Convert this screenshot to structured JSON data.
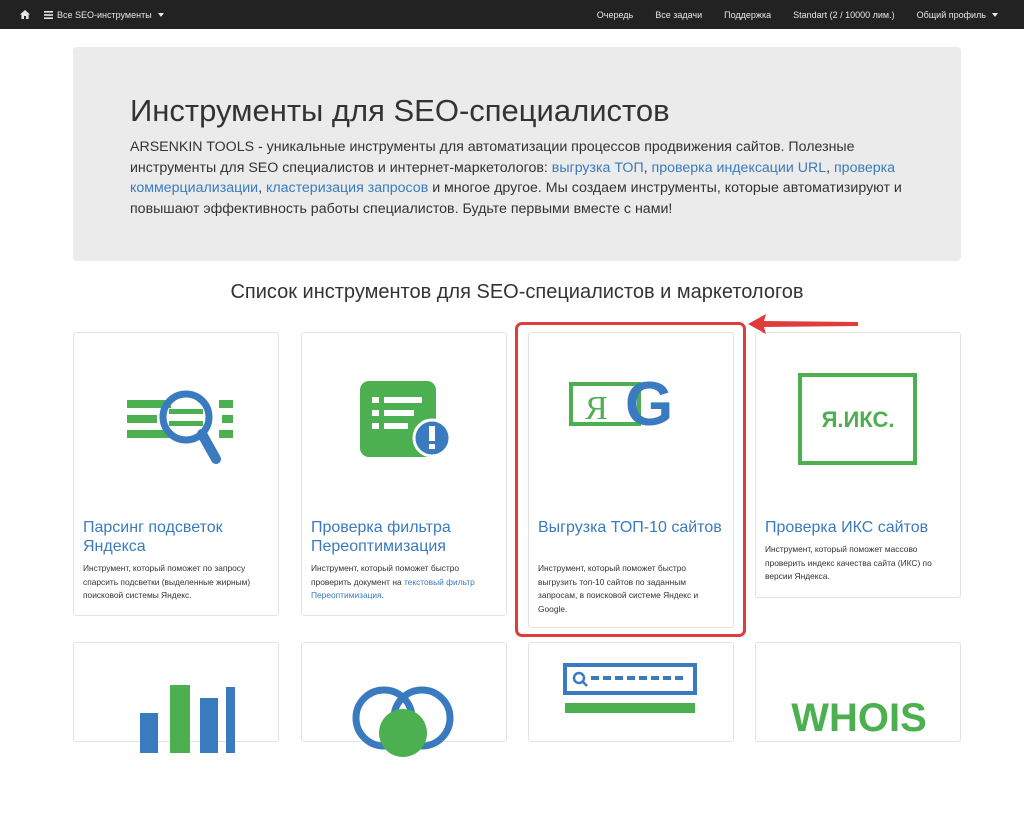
{
  "navbar": {
    "tools_menu": "Все SEO-инструменты",
    "queue": "Очередь",
    "all_tasks": "Все задачи",
    "support": "Поддержка",
    "plan": "Standart (2 / 10000 лим.)",
    "profile": "Общий профиль"
  },
  "jumbotron": {
    "title": "Инструменты для SEO-специалистов",
    "text_1": "ARSENKIN TOOLS - уникальные инструменты для автоматизации процессов продвижения сайтов. Полезные инструменты для SEO специалистов и интернет-маркетологов: ",
    "link_1": "выгрузка ТОП",
    "sep_1": ", ",
    "link_2": "проверка индексации URL",
    "sep_2": ", ",
    "link_3": "проверка коммерциализации",
    "sep_3": ", ",
    "link_4": "кластеризация запросов",
    "text_2": " и многое другое. Мы создаем инструменты, которые автоматизируют и повышают эффективность работы специалистов. Будьте первыми вместе с нами!"
  },
  "section_title": "Список инструментов для SEO-специалистов и маркетологов",
  "cards": [
    {
      "title": "Парсинг подсветок Яндекса",
      "desc": "Инструмент, который поможет по запросу спарсить подсветки (выделенные жирным) поисковой системы Яндекс."
    },
    {
      "title": "Проверка фильтра Переоптимизация",
      "desc_1": "Инструмент, который поможет быстро проверить документ на ",
      "desc_link": "текстовый фильтр Переоптимизация",
      "desc_2": "."
    },
    {
      "title": "Выгрузка ТОП-10 сайтов",
      "desc": "Инструмент, который поможет быстро выгрузить топ-10 сайтов по заданным запросам, в поисковой системе Яндекс и Google."
    },
    {
      "title": "Проверка ИКС сайтов",
      "desc": "Инструмент, который поможет массово проверить индекс качества сайта (ИКС) по версии Яндекса."
    }
  ],
  "logos": {
    "ya_letter": "Я",
    "g_letter": "G",
    "yaiks": "Я.ИКС.",
    "whois": "WHOIS"
  },
  "colors": {
    "green": "#4caf50",
    "blue": "#3a7bbf",
    "highlight": "#e03c3c",
    "navbar": "#222222"
  },
  "icons": [
    "home-icon",
    "menu-icon",
    "search-icon",
    "warning-icon",
    "bar-chart-icon",
    "arrow-left-icon"
  ]
}
